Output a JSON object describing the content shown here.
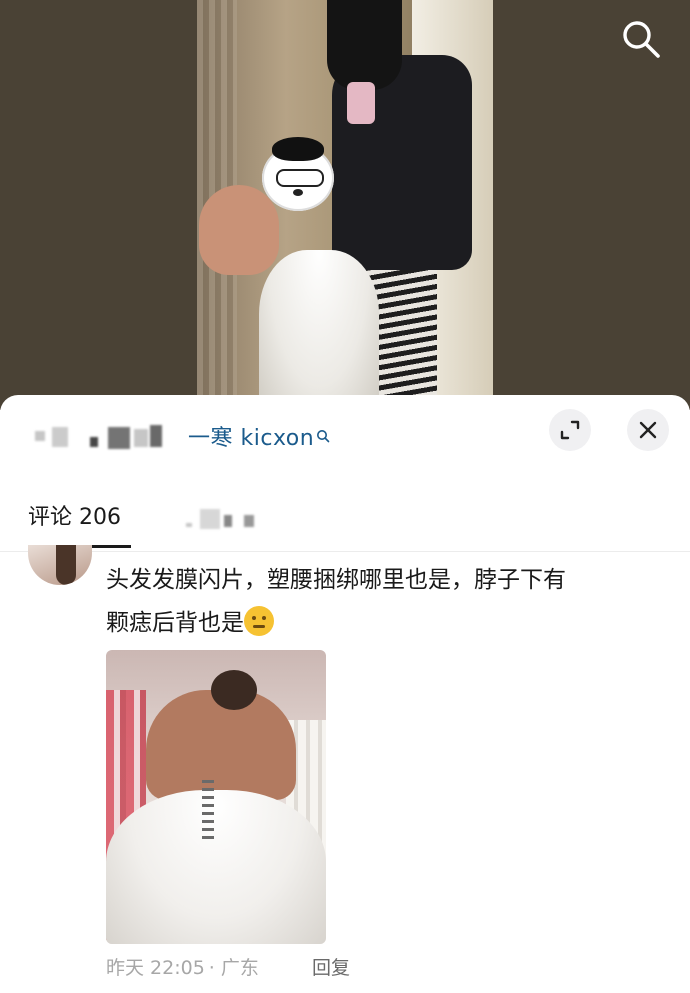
{
  "header": {
    "username": "一寒 kicxon",
    "close_label": "close",
    "expand_label": "expand"
  },
  "tabs": {
    "comments_label": "评论 206"
  },
  "comment": {
    "text_line1": "头发发膜闪片，塑腰捆绑哪里也是，脖子下有",
    "text_line2": "颗痣后背也是",
    "timestamp": "昨天 22:05",
    "location": "· 广东",
    "reply_label": "回复"
  },
  "icons": {
    "top_right": "search-icon",
    "user_link_suffix": "search-icon",
    "expand": "expand-icon",
    "close": "close-icon",
    "emoji": "smirk-emoji"
  },
  "colors": {
    "link": "#1b5b8c",
    "text": "#1a1a1a",
    "meta": "#a7a7a7"
  }
}
